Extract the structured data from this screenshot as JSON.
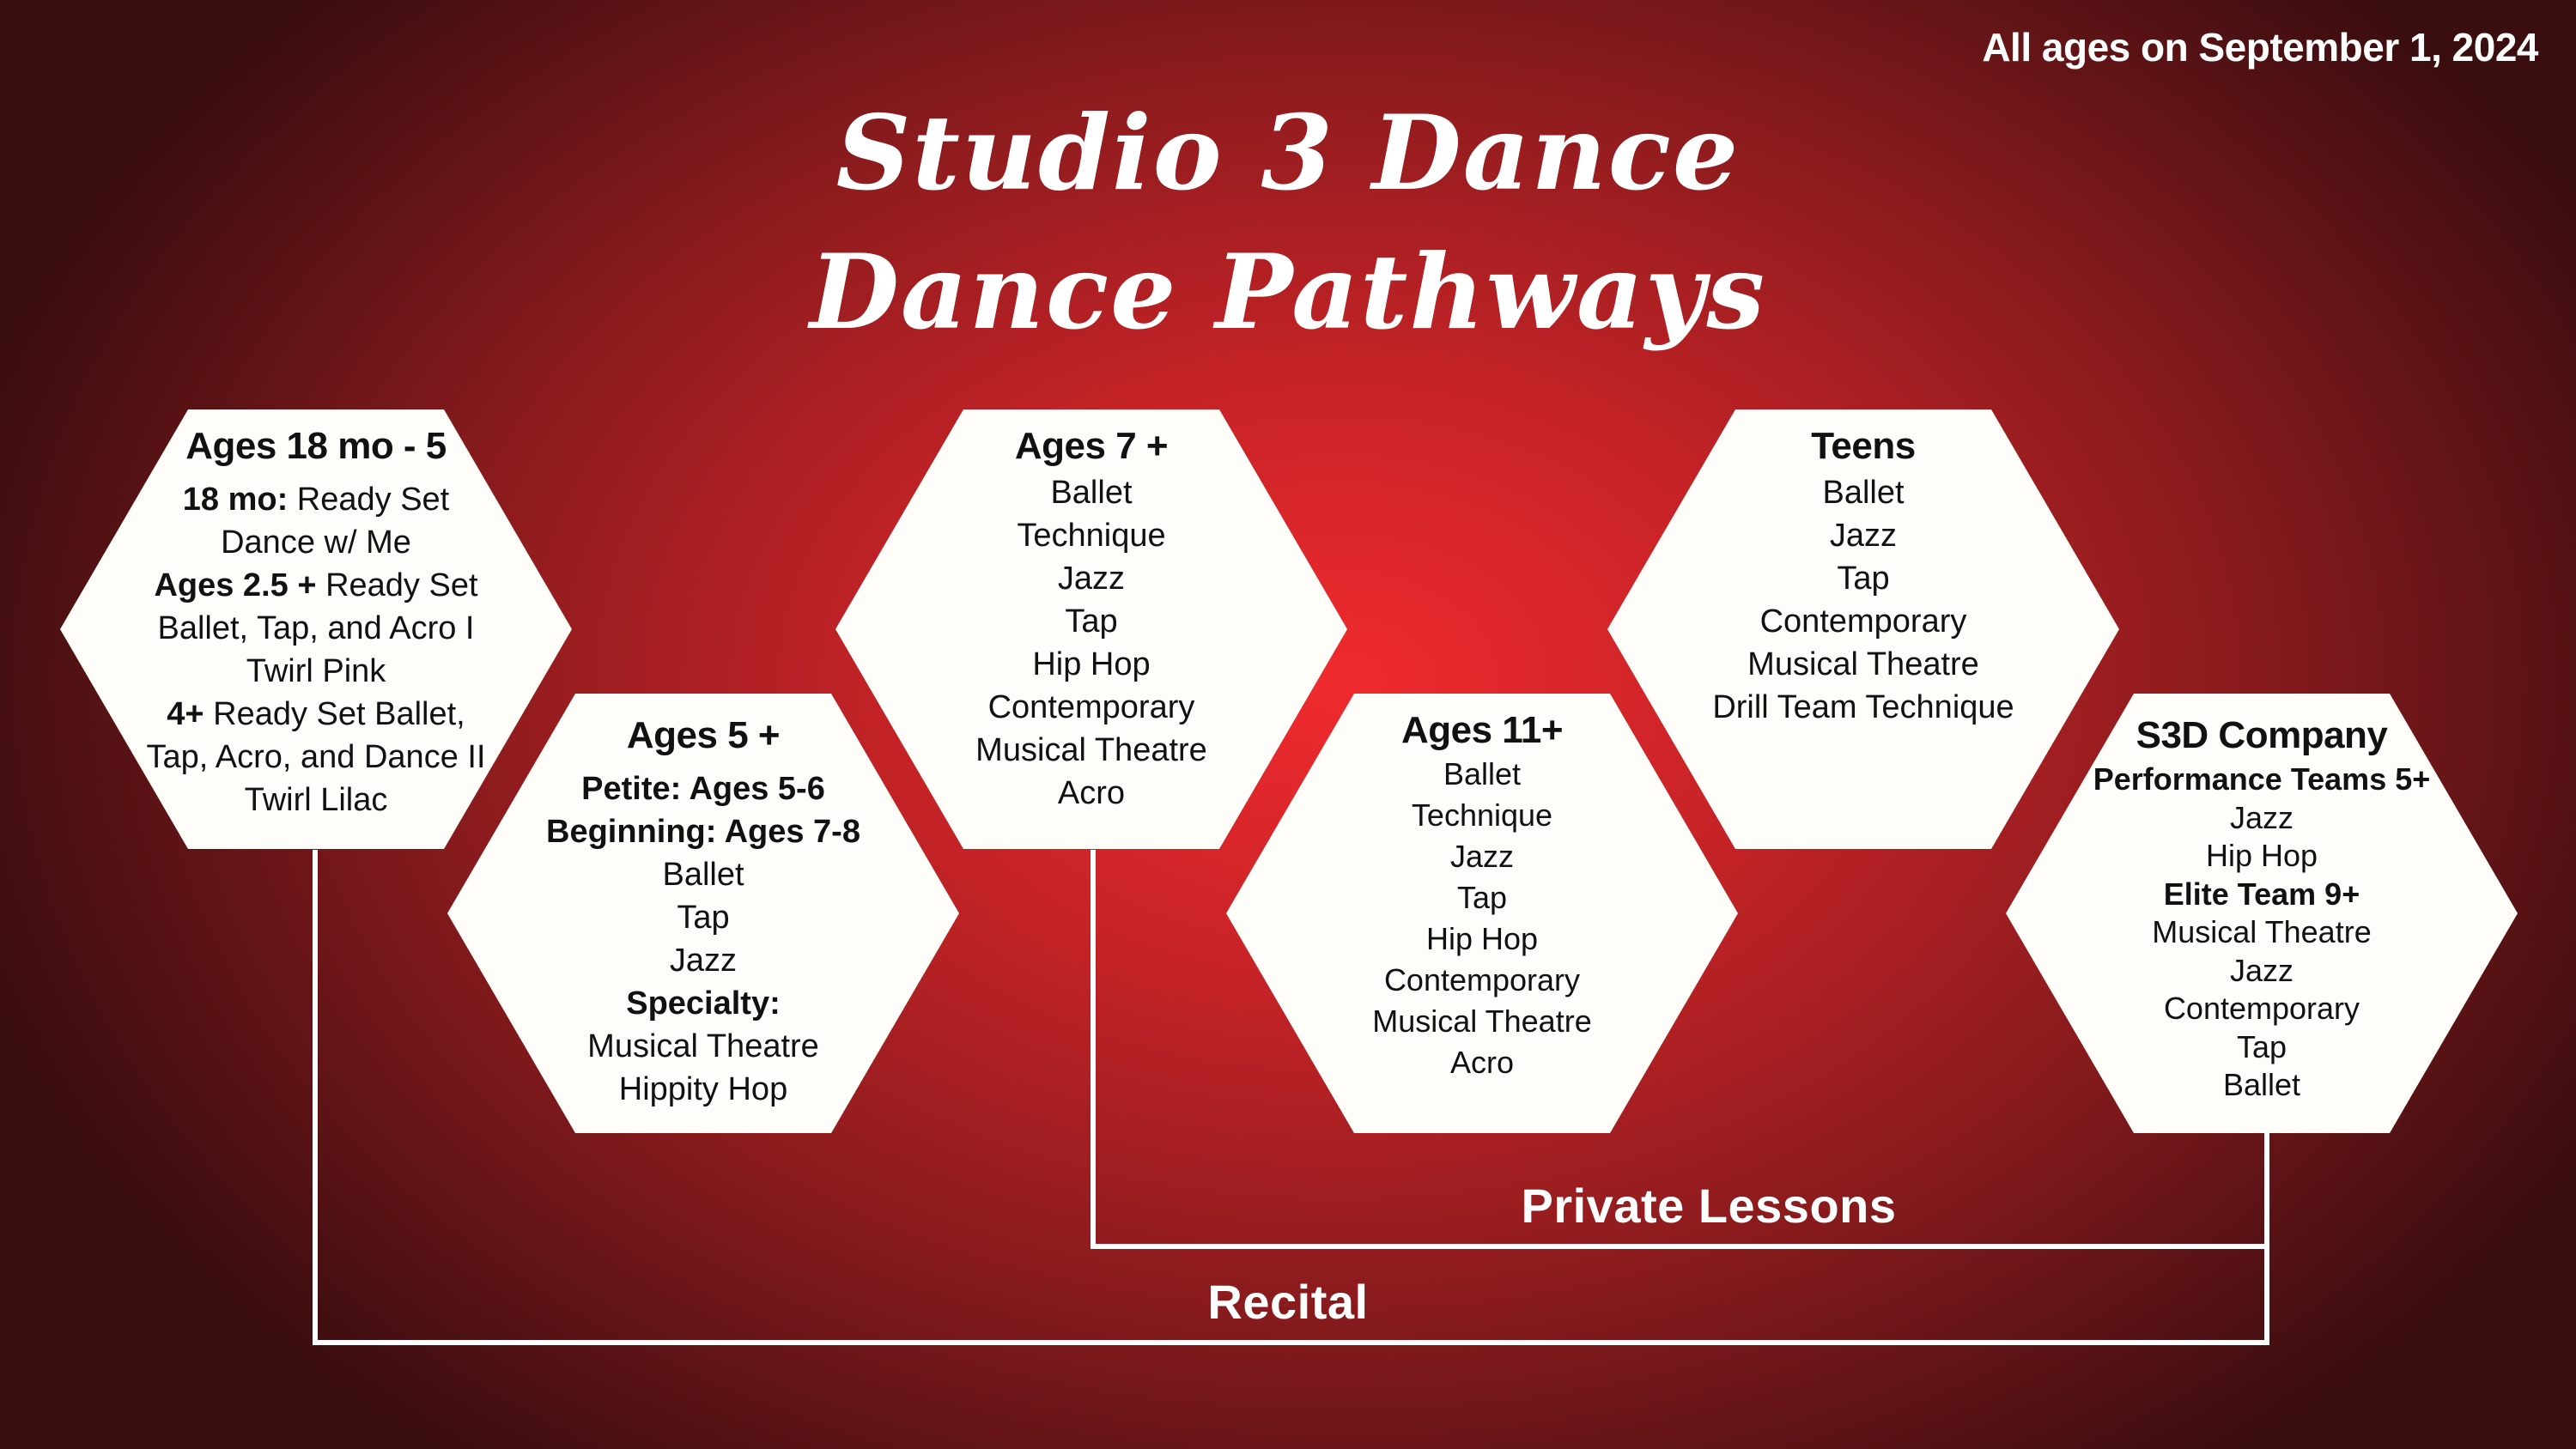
{
  "note": "All ages on September 1, 2024",
  "title": {
    "line1": "Studio 3 Dance",
    "line2": "Dance Pathways"
  },
  "hexes": {
    "toddler": {
      "title": "Ages 18 mo - 5",
      "lines": [
        {
          "bold": "18 mo:",
          "text": " Ready Set"
        },
        {
          "bold": "",
          "text": "Dance w/ Me"
        },
        {
          "bold": "Ages 2.5 +",
          "text": " Ready Set"
        },
        {
          "bold": "",
          "text": "Ballet, Tap, and Acro I"
        },
        {
          "bold": "",
          "text": "Twirl Pink"
        },
        {
          "bold": "4+",
          "text": " Ready Set Ballet,"
        },
        {
          "bold": "",
          "text": "Tap, Acro, and Dance II"
        },
        {
          "bold": "",
          "text": "Twirl Lilac"
        }
      ]
    },
    "ages5": {
      "title": "Ages 5 +",
      "lines": [
        {
          "bold": "Petite: Ages 5-6",
          "text": ""
        },
        {
          "bold": "Beginning: Ages 7-8",
          "text": ""
        },
        {
          "bold": "",
          "text": "Ballet"
        },
        {
          "bold": "",
          "text": "Tap"
        },
        {
          "bold": "",
          "text": "Jazz"
        },
        {
          "bold": "Specialty:",
          "text": ""
        },
        {
          "bold": "",
          "text": "Musical Theatre"
        },
        {
          "bold": "",
          "text": "Hippity Hop"
        }
      ]
    },
    "ages7": {
      "title": "Ages 7 +",
      "lines": [
        {
          "bold": "",
          "text": "Ballet"
        },
        {
          "bold": "",
          "text": "Technique"
        },
        {
          "bold": "",
          "text": "Jazz"
        },
        {
          "bold": "",
          "text": "Tap"
        },
        {
          "bold": "",
          "text": "Hip Hop"
        },
        {
          "bold": "",
          "text": "Contemporary"
        },
        {
          "bold": "",
          "text": "Musical Theatre"
        },
        {
          "bold": "",
          "text": "Acro"
        }
      ]
    },
    "ages11": {
      "title": "Ages 11+",
      "lines": [
        {
          "bold": "",
          "text": "Ballet"
        },
        {
          "bold": "",
          "text": "Technique"
        },
        {
          "bold": "",
          "text": "Jazz"
        },
        {
          "bold": "",
          "text": "Tap"
        },
        {
          "bold": "",
          "text": "Hip Hop"
        },
        {
          "bold": "",
          "text": "Contemporary"
        },
        {
          "bold": "",
          "text": "Musical Theatre"
        },
        {
          "bold": "",
          "text": "Acro"
        }
      ]
    },
    "teens": {
      "title": "Teens",
      "lines": [
        {
          "bold": "",
          "text": "Ballet"
        },
        {
          "bold": "",
          "text": "Jazz"
        },
        {
          "bold": "",
          "text": "Tap"
        },
        {
          "bold": "",
          "text": "Contemporary"
        },
        {
          "bold": "",
          "text": "Musical Theatre"
        },
        {
          "bold": "",
          "text": "Drill Team Technique"
        }
      ]
    },
    "company": {
      "title": "S3D Company",
      "lines": [
        {
          "bold": "Performance Teams 5+",
          "text": ""
        },
        {
          "bold": "",
          "text": "Jazz"
        },
        {
          "bold": "",
          "text": "Hip Hop"
        },
        {
          "bold": "Elite Team 9+",
          "text": ""
        },
        {
          "bold": "",
          "text": "Musical Theatre"
        },
        {
          "bold": "",
          "text": "Jazz"
        },
        {
          "bold": "",
          "text": "Contemporary"
        },
        {
          "bold": "",
          "text": "Tap"
        },
        {
          "bold": "",
          "text": "Ballet"
        }
      ]
    }
  },
  "pathways": {
    "private_lessons": "Private Lessons",
    "recital": "Recital"
  },
  "colors": {
    "background_center": "#f02a2e",
    "background_edge": "#3a0d0f",
    "hex_fill": "#fffdf9",
    "line": "#ffffff"
  }
}
